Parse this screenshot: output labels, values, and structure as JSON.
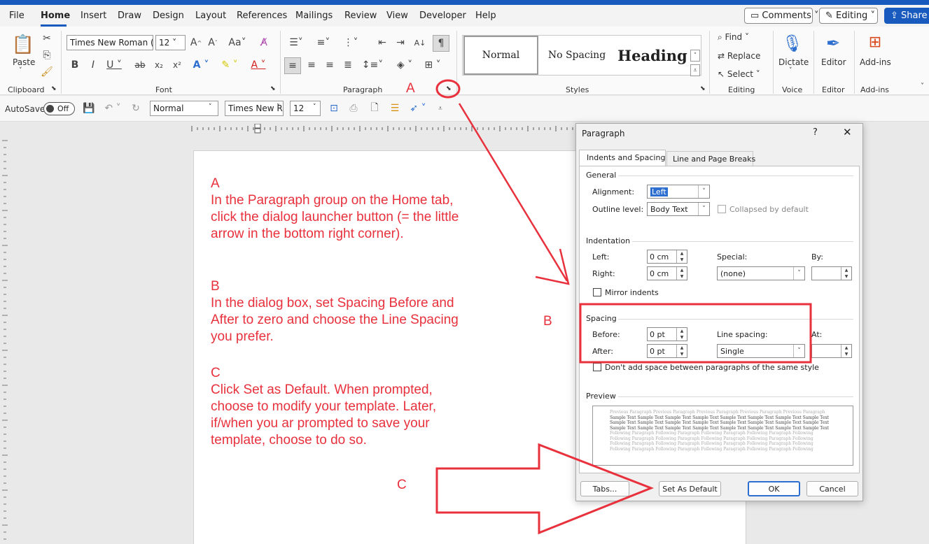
{
  "tabs": [
    "File",
    "Home",
    "Insert",
    "Draw",
    "Design",
    "Layout",
    "References",
    "Mailings",
    "Review",
    "View",
    "Developer",
    "Help"
  ],
  "top_right": {
    "comments": "Comments",
    "editing": "Editing",
    "share": "Share"
  },
  "clipboard": {
    "paste": "Paste",
    "label": "Clipboard"
  },
  "font": {
    "name": "Times New Roman (",
    "size": "12",
    "label": "Font"
  },
  "paragraph": {
    "label": "Paragraph"
  },
  "styles": {
    "normal": "Normal",
    "no_spacing": "No Spacing",
    "heading": "Heading",
    "label": "Styles"
  },
  "editing": {
    "find": "Find",
    "replace": "Replace",
    "select": "Select",
    "label": "Editing"
  },
  "voice": {
    "dictate": "Dictate",
    "label": "Voice"
  },
  "editor": {
    "editor": "Editor",
    "label": "Editor"
  },
  "addins": {
    "addins": "Add-ins",
    "label": "Add-ins"
  },
  "qat": {
    "autosave": "AutoSave",
    "off": "Off",
    "style": "Normal",
    "font": "Times New Ro",
    "size": "12"
  },
  "annotations": {
    "a_heading": "A",
    "a_text": "In the Paragraph group on the Home tab, click the dialog launcher button (= the little arrow in the bottom right corner).",
    "b_heading": "B",
    "b_text": "In the dialog box, set Spacing Before and After to zero and choose the Line Spacing you prefer.",
    "c_heading": "C",
    "c_text": "Click Set as Default. When prompted, choose to modify your template. Later, if/when you ar prompted to save your template, choose to do so.",
    "label_a": "A",
    "label_b": "B",
    "label_c": "C"
  },
  "dialog": {
    "title": "Paragraph",
    "help": "?",
    "tab1": "Indents and Spacing",
    "tab2": "Line and Page Breaks",
    "general": "General",
    "alignment_label": "Alignment:",
    "alignment_value": "Left",
    "outline_label": "Outline level:",
    "outline_value": "Body Text",
    "collapsed": "Collapsed by default",
    "indentation": "Indentation",
    "left_label": "Left:",
    "left_value": "0 cm",
    "right_label": "Right:",
    "right_value": "0 cm",
    "special_label": "Special:",
    "special_value": "(none)",
    "by_label": "By:",
    "mirror": "Mirror indents",
    "spacing": "Spacing",
    "before_label": "Before:",
    "before_value": "0 pt",
    "after_label": "After:",
    "after_value": "0 pt",
    "line_spacing_label": "Line spacing:",
    "line_spacing_value": "Single",
    "at_label": "At:",
    "dont_add": "Don't add space between paragraphs of the same style",
    "preview": "Preview",
    "preview_prev": "Previous Paragraph Previous Paragraph Previous Paragraph Previous Paragraph Previous Paragraph",
    "preview_sample": "Sample Text Sample Text Sample Text Sample Text Sample Text Sample Text Sample Text Sample Text",
    "preview_follow": "Following Paragraph Following Paragraph Following Paragraph Following Paragraph Following",
    "tabs_btn": "Tabs...",
    "default_btn": "Set As Default",
    "ok_btn": "OK",
    "cancel_btn": "Cancel"
  }
}
